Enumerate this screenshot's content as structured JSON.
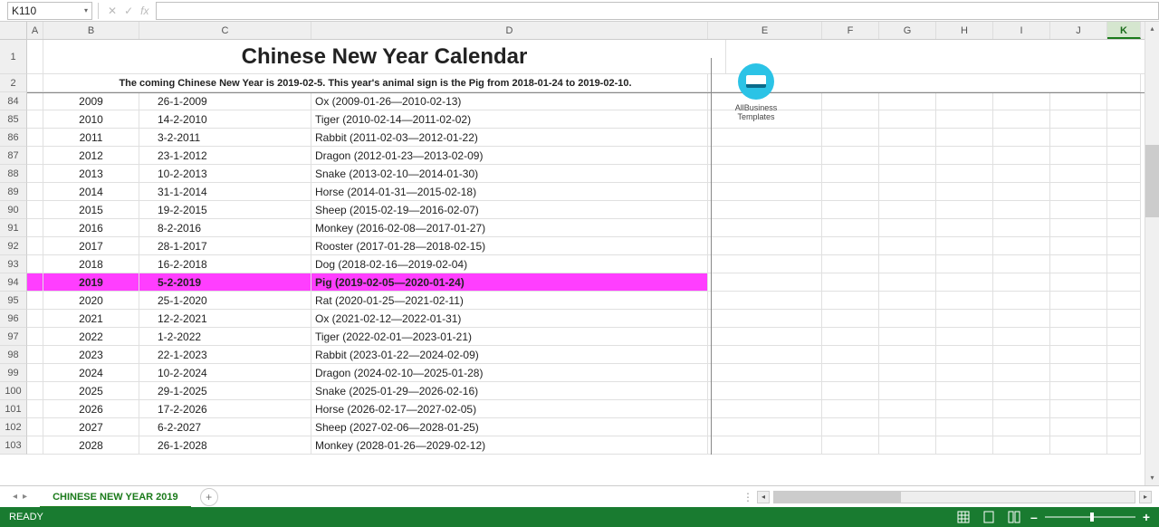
{
  "name_box": {
    "value": "K110",
    "caret": "▾"
  },
  "fx": {
    "cancel": "✕",
    "confirm": "✓",
    "label": "fx"
  },
  "columns": [
    "A",
    "B",
    "C",
    "D",
    "E",
    "F",
    "G",
    "H",
    "I",
    "J",
    "K"
  ],
  "active_column": "K",
  "frozen_rows": {
    "r1": {
      "num": "1",
      "title": "Chinese New Year Calendar"
    },
    "r2": {
      "num": "2",
      "subtitle": "The coming Chinese New Year is 2019-02-5. This year's animal sign is the Pig from 2018-01-24 to 2019-02-10."
    }
  },
  "logo": {
    "line1": "AllBusiness",
    "line2": "Templates"
  },
  "rows": [
    {
      "n": "84",
      "b": "2009",
      "c": "26-1-2009",
      "d": "Ox (2009-01-26—2010-02-13)"
    },
    {
      "n": "85",
      "b": "2010",
      "c": "14-2-2010",
      "d": "Tiger (2010-02-14—2011-02-02)"
    },
    {
      "n": "86",
      "b": "2011",
      "c": "3-2-2011",
      "d": "Rabbit (2011-02-03—2012-01-22)"
    },
    {
      "n": "87",
      "b": "2012",
      "c": "23-1-2012",
      "d": "Dragon (2012-01-23—2013-02-09)"
    },
    {
      "n": "88",
      "b": "2013",
      "c": "10-2-2013",
      "d": "Snake (2013-02-10—2014-01-30)"
    },
    {
      "n": "89",
      "b": "2014",
      "c": "31-1-2014",
      "d": "Horse (2014-01-31—2015-02-18)"
    },
    {
      "n": "90",
      "b": "2015",
      "c": "19-2-2015",
      "d": "Sheep (2015-02-19—2016-02-07)"
    },
    {
      "n": "91",
      "b": "2016",
      "c": "8-2-2016",
      "d": "Monkey (2016-02-08—2017-01-27)"
    },
    {
      "n": "92",
      "b": "2017",
      "c": "28-1-2017",
      "d": "Rooster (2017-01-28—2018-02-15)"
    },
    {
      "n": "93",
      "b": "2018",
      "c": "16-2-2018",
      "d": "Dog (2018-02-16—2019-02-04)"
    },
    {
      "n": "94",
      "b": "2019",
      "c": "5-2-2019",
      "d": "Pig (2019-02-05—2020-01-24)",
      "hl": true
    },
    {
      "n": "95",
      "b": "2020",
      "c": "25-1-2020",
      "d": "Rat (2020-01-25—2021-02-11)"
    },
    {
      "n": "96",
      "b": "2021",
      "c": "12-2-2021",
      "d": "Ox (2021-02-12—2022-01-31)"
    },
    {
      "n": "97",
      "b": "2022",
      "c": "1-2-2022",
      "d": "Tiger (2022-02-01—2023-01-21)"
    },
    {
      "n": "98",
      "b": "2023",
      "c": "22-1-2023",
      "d": "Rabbit (2023-01-22—2024-02-09)"
    },
    {
      "n": "99",
      "b": "2024",
      "c": "10-2-2024",
      "d": "Dragon (2024-02-10—2025-01-28)"
    },
    {
      "n": "100",
      "b": "2025",
      "c": "29-1-2025",
      "d": "Snake (2025-01-29—2026-02-16)"
    },
    {
      "n": "101",
      "b": "2026",
      "c": "17-2-2026",
      "d": "Horse (2026-02-17—2027-02-05)"
    },
    {
      "n": "102",
      "b": "2027",
      "c": "6-2-2027",
      "d": "Sheep (2027-02-06—2028-01-25)"
    },
    {
      "n": "103",
      "b": "2028",
      "c": "26-1-2028",
      "d": "Monkey (2028-01-26—2029-02-12)"
    }
  ],
  "sheet_tab": {
    "name": "CHINESE NEW YEAR 2019",
    "add": "+"
  },
  "tab_nav": {
    "first": "◂",
    "prev": "▸"
  },
  "hscroll": {
    "left": "◂",
    "right": "▸",
    "resize": "⋮"
  },
  "status": {
    "ready": "READY",
    "plus": "+",
    "minus": "–",
    "vscroll_up": "▴",
    "vscroll_down": "▾"
  }
}
